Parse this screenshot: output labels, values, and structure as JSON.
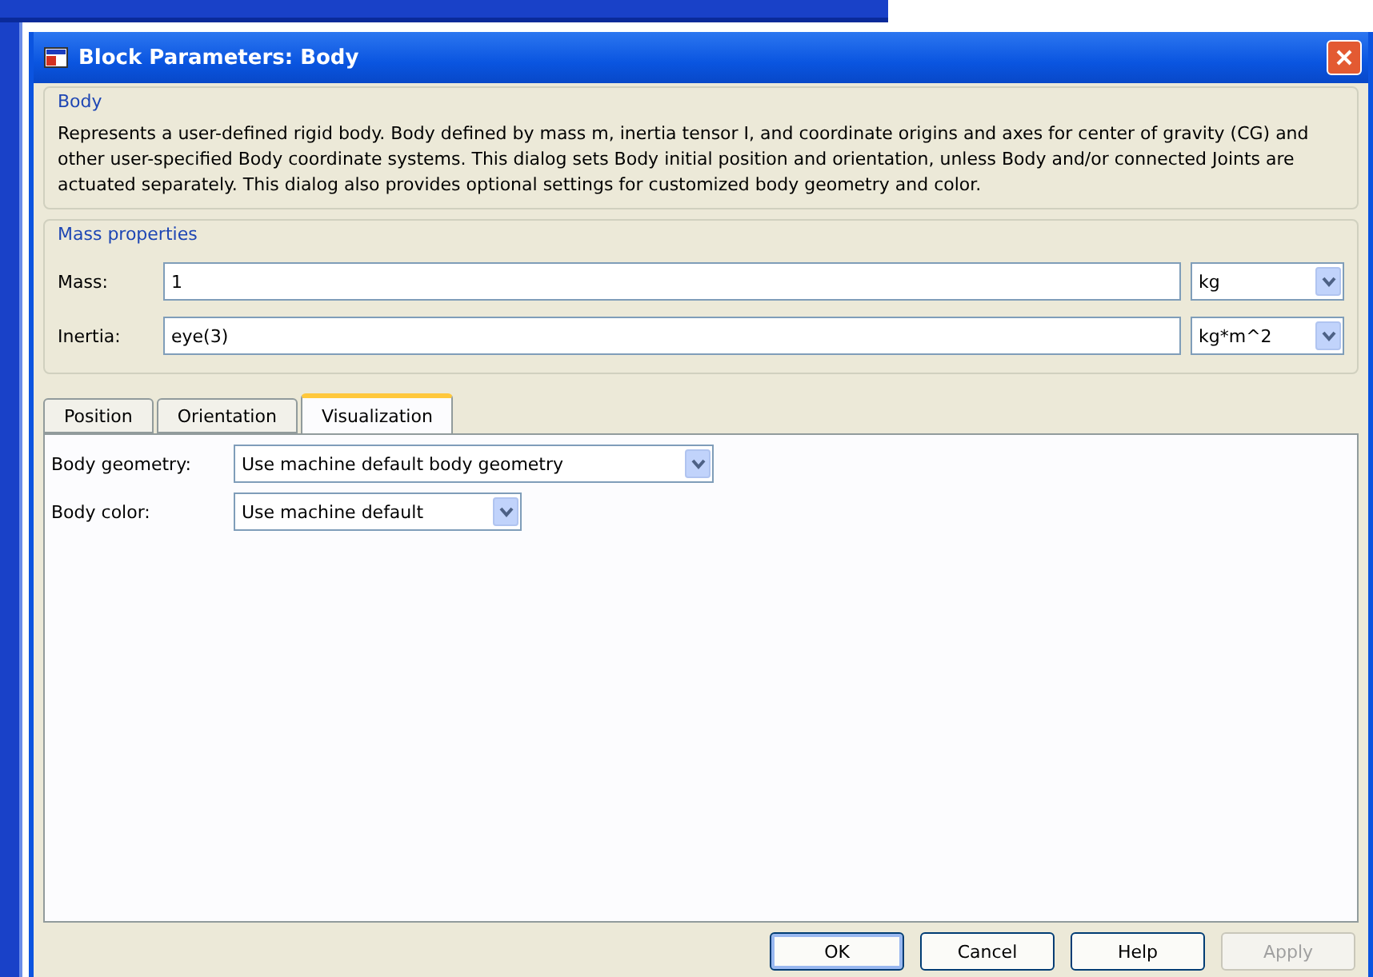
{
  "window": {
    "title": "Block Parameters: Body"
  },
  "description": {
    "heading": "Body",
    "text": "Represents a user-defined rigid body. Body defined by mass m, inertia tensor I, and coordinate origins and axes for center of gravity (CG) and other user-specified Body coordinate systems. This dialog sets Body initial position and orientation, unless Body and/or connected Joints are actuated separately. This dialog also provides optional settings for customized body geometry and color."
  },
  "mass_properties": {
    "heading": "Mass properties",
    "fields": [
      {
        "label": "Mass:",
        "value": "1",
        "unit": "kg"
      },
      {
        "label": "Inertia:",
        "value": "eye(3)",
        "unit": "kg*m^2"
      }
    ]
  },
  "tabs": [
    {
      "label": "Position",
      "selected": false
    },
    {
      "label": "Orientation",
      "selected": false
    },
    {
      "label": "Visualization",
      "selected": true
    }
  ],
  "visualization": [
    {
      "label": "Body geometry:",
      "value": "Use machine default body geometry"
    },
    {
      "label": "Body color:",
      "value": "Use machine default"
    }
  ],
  "buttons": [
    {
      "label": "OK",
      "disabled": false,
      "default": true
    },
    {
      "label": "Cancel",
      "disabled": false,
      "default": false
    },
    {
      "label": "Help",
      "disabled": false,
      "default": false
    },
    {
      "label": "Apply",
      "disabled": true,
      "default": false
    }
  ]
}
